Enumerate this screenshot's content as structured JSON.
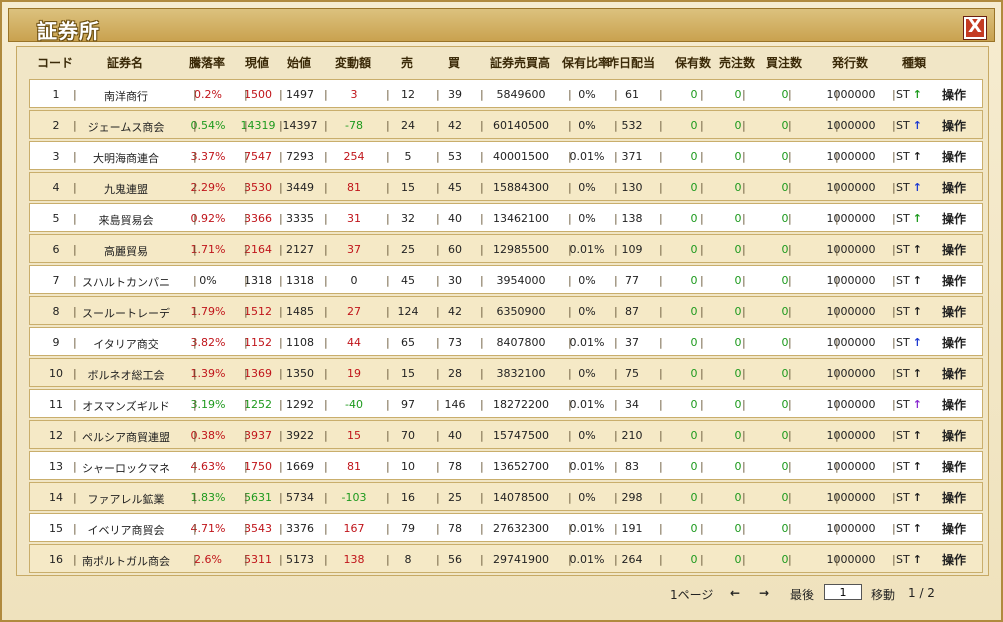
{
  "window": {
    "title": "証券所",
    "close_label": "X"
  },
  "columns": [
    "コード",
    "証券名",
    "騰落率",
    "現値",
    "始値",
    "変動額",
    "売",
    "買",
    "証券売買高",
    "保有比率",
    "昨日配当",
    "保有数",
    "売注数",
    "買注数",
    "発行数",
    "種類"
  ],
  "rows": [
    {
      "code": "1",
      "name": "南洋商行",
      "rate": "0.2%",
      "now": "1500",
      "open": "1497",
      "change": "3",
      "sell": "12",
      "buy": "39",
      "volume": "5849600",
      "ratio": "0%",
      "div": "61",
      "hold": "0",
      "sellq": "0",
      "buyq": "0",
      "issued": "1000000",
      "type": "ST",
      "up": true,
      "arrow": "↑",
      "arrow_color": "#1e9a1e",
      "op": "操作"
    },
    {
      "code": "2",
      "name": "ジェームス商会",
      "rate": "0.54%",
      "now": "14319",
      "open": "14397",
      "change": "-78",
      "sell": "24",
      "buy": "42",
      "volume": "60140500",
      "ratio": "0%",
      "div": "532",
      "hold": "0",
      "sellq": "0",
      "buyq": "0",
      "issued": "1000000",
      "type": "ST",
      "up": false,
      "arrow": "↑",
      "arrow_color": "#1e3ad0",
      "op": "操作"
    },
    {
      "code": "3",
      "name": "大明海商連合",
      "rate": "3.37%",
      "now": "7547",
      "open": "7293",
      "change": "254",
      "sell": "5",
      "buy": "53",
      "volume": "40001500",
      "ratio": "0.01%",
      "div": "371",
      "hold": "0",
      "sellq": "0",
      "buyq": "0",
      "issued": "1000000",
      "type": "ST",
      "up": true,
      "arrow": "↑",
      "arrow_color": "#222222",
      "op": "操作"
    },
    {
      "code": "4",
      "name": "九鬼連盟",
      "rate": "2.29%",
      "now": "3530",
      "open": "3449",
      "change": "81",
      "sell": "15",
      "buy": "45",
      "volume": "15884300",
      "ratio": "0%",
      "div": "130",
      "hold": "0",
      "sellq": "0",
      "buyq": "0",
      "issued": "1000000",
      "type": "ST",
      "up": true,
      "arrow": "↑",
      "arrow_color": "#1e3ad0",
      "op": "操作"
    },
    {
      "code": "5",
      "name": "来島貿易会",
      "rate": "0.92%",
      "now": "3366",
      "open": "3335",
      "change": "31",
      "sell": "32",
      "buy": "40",
      "volume": "13462100",
      "ratio": "0%",
      "div": "138",
      "hold": "0",
      "sellq": "0",
      "buyq": "0",
      "issued": "1000000",
      "type": "ST",
      "up": true,
      "arrow": "↑",
      "arrow_color": "#1e9a1e",
      "op": "操作"
    },
    {
      "code": "6",
      "name": "高麗貿易",
      "rate": "1.71%",
      "now": "2164",
      "open": "2127",
      "change": "37",
      "sell": "25",
      "buy": "60",
      "volume": "12985500",
      "ratio": "0.01%",
      "div": "109",
      "hold": "0",
      "sellq": "0",
      "buyq": "0",
      "issued": "1000000",
      "type": "ST",
      "up": true,
      "arrow": "↑",
      "arrow_color": "#222222",
      "op": "操作"
    },
    {
      "code": "7",
      "name": "スハルトカンパニ",
      "rate": "0%",
      "now": "1318",
      "open": "1318",
      "change": "0",
      "sell": "45",
      "buy": "30",
      "volume": "3954000",
      "ratio": "0%",
      "div": "77",
      "hold": "0",
      "sellq": "0",
      "buyq": "0",
      "issued": "1000000",
      "type": "ST",
      "up": null,
      "arrow": "↑",
      "arrow_color": "#222222",
      "op": "操作"
    },
    {
      "code": "8",
      "name": "スールートレーデ",
      "rate": "1.79%",
      "now": "1512",
      "open": "1485",
      "change": "27",
      "sell": "124",
      "buy": "42",
      "volume": "6350900",
      "ratio": "0%",
      "div": "87",
      "hold": "0",
      "sellq": "0",
      "buyq": "0",
      "issued": "1000000",
      "type": "ST",
      "up": true,
      "arrow": "↑",
      "arrow_color": "#222222",
      "op": "操作"
    },
    {
      "code": "9",
      "name": "イタリア商交",
      "rate": "3.82%",
      "now": "1152",
      "open": "1108",
      "change": "44",
      "sell": "65",
      "buy": "73",
      "volume": "8407800",
      "ratio": "0.01%",
      "div": "37",
      "hold": "0",
      "sellq": "0",
      "buyq": "0",
      "issued": "1000000",
      "type": "ST",
      "up": true,
      "arrow": "↑",
      "arrow_color": "#1e3ad0",
      "op": "操作"
    },
    {
      "code": "10",
      "name": "ボルネオ総工会",
      "rate": "1.39%",
      "now": "1369",
      "open": "1350",
      "change": "19",
      "sell": "15",
      "buy": "28",
      "volume": "3832100",
      "ratio": "0%",
      "div": "75",
      "hold": "0",
      "sellq": "0",
      "buyq": "0",
      "issued": "1000000",
      "type": "ST",
      "up": true,
      "arrow": "↑",
      "arrow_color": "#222222",
      "op": "操作"
    },
    {
      "code": "11",
      "name": "オスマンズギルド",
      "rate": "3.19%",
      "now": "1252",
      "open": "1292",
      "change": "-40",
      "sell": "97",
      "buy": "146",
      "volume": "18272200",
      "ratio": "0.01%",
      "div": "34",
      "hold": "0",
      "sellq": "0",
      "buyq": "0",
      "issued": "1000000",
      "type": "ST",
      "up": false,
      "arrow": "↑",
      "arrow_color": "#8a2ad0",
      "op": "操作"
    },
    {
      "code": "12",
      "name": "ペルシア商貿連盟",
      "rate": "0.38%",
      "now": "3937",
      "open": "3922",
      "change": "15",
      "sell": "70",
      "buy": "40",
      "volume": "15747500",
      "ratio": "0%",
      "div": "210",
      "hold": "0",
      "sellq": "0",
      "buyq": "0",
      "issued": "1000000",
      "type": "ST",
      "up": true,
      "arrow": "↑",
      "arrow_color": "#222222",
      "op": "操作"
    },
    {
      "code": "13",
      "name": "シャーロックマネ",
      "rate": "4.63%",
      "now": "1750",
      "open": "1669",
      "change": "81",
      "sell": "10",
      "buy": "78",
      "volume": "13652700",
      "ratio": "0.01%",
      "div": "83",
      "hold": "0",
      "sellq": "0",
      "buyq": "0",
      "issued": "1000000",
      "type": "ST",
      "up": true,
      "arrow": "↑",
      "arrow_color": "#222222",
      "op": "操作"
    },
    {
      "code": "14",
      "name": "ファアレル鉱業",
      "rate": "1.83%",
      "now": "5631",
      "open": "5734",
      "change": "-103",
      "sell": "16",
      "buy": "25",
      "volume": "14078500",
      "ratio": "0%",
      "div": "298",
      "hold": "0",
      "sellq": "0",
      "buyq": "0",
      "issued": "1000000",
      "type": "ST",
      "up": false,
      "arrow": "↑",
      "arrow_color": "#222222",
      "op": "操作"
    },
    {
      "code": "15",
      "name": "イベリア商貿会",
      "rate": "4.71%",
      "now": "3543",
      "open": "3376",
      "change": "167",
      "sell": "79",
      "buy": "78",
      "volume": "27632300",
      "ratio": "0.01%",
      "div": "191",
      "hold": "0",
      "sellq": "0",
      "buyq": "0",
      "issued": "1000000",
      "type": "ST",
      "up": true,
      "arrow": "↑",
      "arrow_color": "#222222",
      "op": "操作"
    },
    {
      "code": "16",
      "name": "南ポルトガル商会",
      "rate": "2.6%",
      "now": "5311",
      "open": "5173",
      "change": "138",
      "sell": "8",
      "buy": "56",
      "volume": "29741900",
      "ratio": "0.01%",
      "div": "264",
      "hold": "0",
      "sellq": "0",
      "buyq": "0",
      "issued": "1000000",
      "type": "ST",
      "up": true,
      "arrow": "↑",
      "arrow_color": "#222222",
      "op": "操作"
    }
  ],
  "pager": {
    "page_label": "1ページ",
    "prev": "←",
    "next": "→",
    "last": "最後",
    "input_value": "1",
    "go": "移動",
    "page_count": "1 / 2"
  },
  "colors": {
    "up": "#c0141a",
    "down": "#1e9a1e",
    "zero": "#222222"
  }
}
